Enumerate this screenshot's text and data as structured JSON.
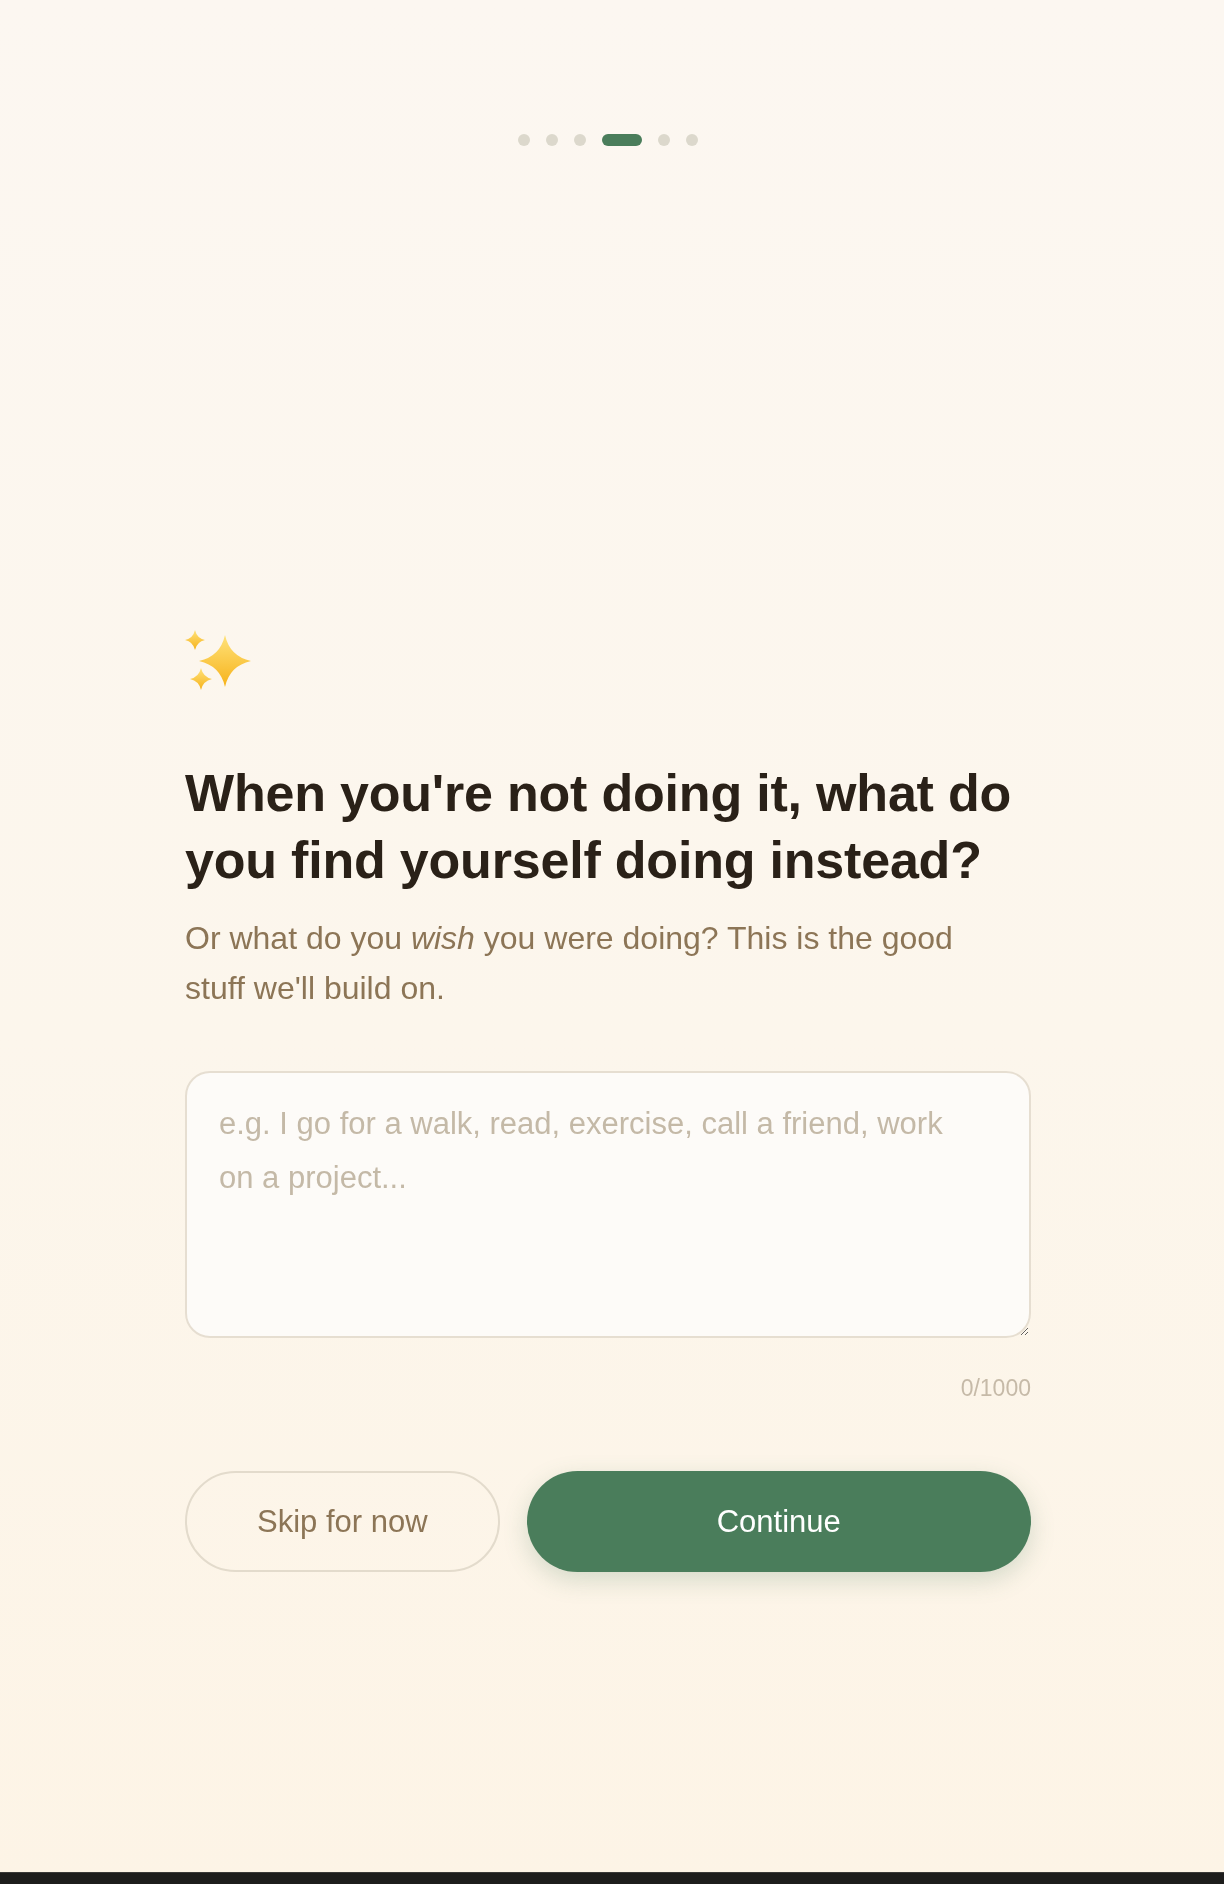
{
  "progress": {
    "steps": [
      {
        "selected": false
      },
      {
        "selected": false
      },
      {
        "selected": false
      },
      {
        "selected": true
      },
      {
        "selected": false
      },
      {
        "selected": false
      }
    ]
  },
  "question": {
    "title": "When you're not doing it, what do you find yourself doing instead?",
    "subtitle": "Or what do you *wish* you were doing? This is the good stuff we'll build on."
  },
  "answer": {
    "placeholder": "e.g. I go for a walk, read, exercise, call a friend, work on a project...",
    "counter": "0/1000"
  },
  "buttons": [
    {
      "label": "Skip for now",
      "kind": "secondary"
    },
    {
      "label": "Continue",
      "kind": "primary"
    }
  ]
}
